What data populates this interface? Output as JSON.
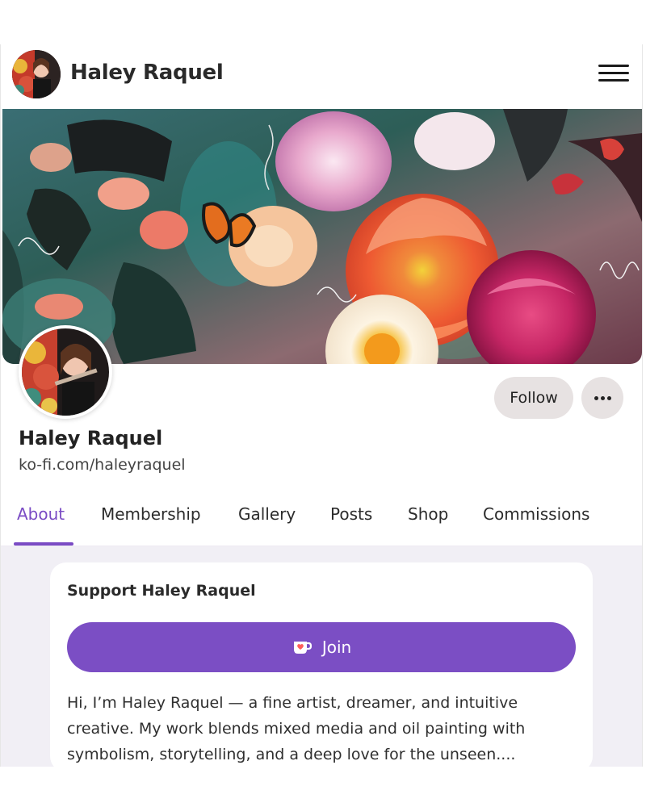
{
  "header": {
    "name": "Haley Raquel"
  },
  "profile": {
    "display_name": "Haley Raquel",
    "url": "ko-fi.com/haleyraquel",
    "follow_label": "Follow"
  },
  "tabs": [
    {
      "label": "About",
      "active": true
    },
    {
      "label": "Membership",
      "active": false
    },
    {
      "label": "Gallery",
      "active": false
    },
    {
      "label": "Posts",
      "active": false
    },
    {
      "label": "Shop",
      "active": false
    },
    {
      "label": "Commissions",
      "active": false
    }
  ],
  "support": {
    "title": "Support Haley Raquel",
    "join_label": "Join",
    "bio": "Hi, I’m Haley Raquel — a fine artist, dreamer, and intuitive creative. My work blends mixed media and oil painting with symbolism, storytelling, and a deep love for the unseen...."
  },
  "colors": {
    "accent": "#7b4ec4",
    "follow_bg": "#e7e2e2",
    "content_bg": "#f1eff5"
  },
  "icons": {
    "menu": "hamburger-menu-icon",
    "more": "more-dots-icon",
    "join": "ko-fi-cup-icon"
  }
}
